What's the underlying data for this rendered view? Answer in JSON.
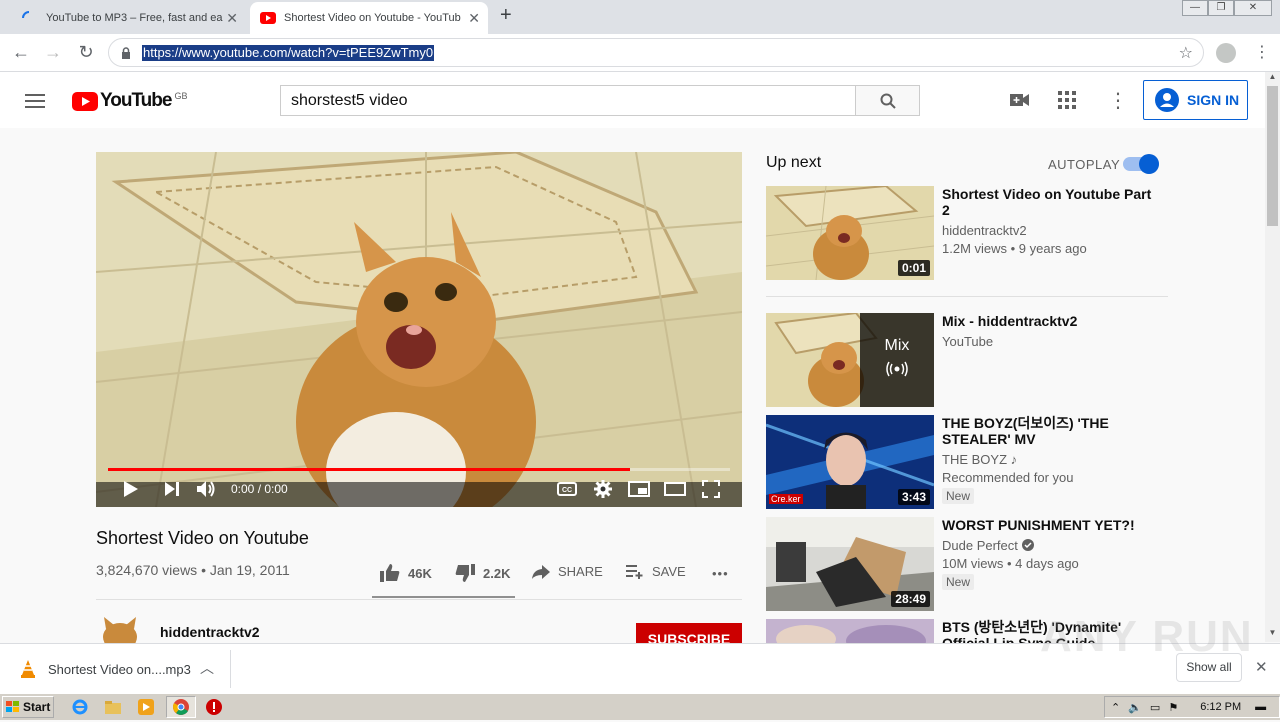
{
  "browser": {
    "tabs": [
      {
        "title": "YouTube to MP3 – Free, fast and ea",
        "close": "✕"
      },
      {
        "title": "Shortest Video on Youtube - YouTub",
        "close": "✕"
      }
    ],
    "new_tab": "+",
    "url": "https://www.youtube.com/watch?v=tPEE9ZwTmy0"
  },
  "youtube": {
    "logo_text": "YouTube",
    "region": "GB",
    "search_value": "shorstest5 video",
    "signin_label": "SIGN IN"
  },
  "video": {
    "time": "0:00 / 0:00",
    "progress_fraction": 0.84,
    "title": "Shortest Video on Youtube",
    "views_date": "3,824,670 views • Jan 19, 2011",
    "likes": "46K",
    "dislikes": "2.2K",
    "share_label": "SHARE",
    "save_label": "SAVE",
    "more": "•••",
    "channel": "hiddentracktv2",
    "subscribe_label": "SUBSCRIBE"
  },
  "sidebar": {
    "up_next": "Up next",
    "autoplay": "AUTOPLAY",
    "items": [
      {
        "title": "Shortest Video on Youtube Part 2",
        "channel": "hiddentracktv2",
        "meta": "1.2M views • 9 years ago",
        "duration": "0:01"
      },
      {
        "title": "Mix - hiddentracktv2",
        "channel": "YouTube",
        "mix_label": "Mix"
      },
      {
        "title": "THE BOYZ(더보이즈) 'THE STEALER' MV",
        "channel": "THE BOYZ",
        "meta": "Recommended for you",
        "badge": "New",
        "duration": "3:43",
        "thumb_text": "Cre.ker"
      },
      {
        "title": "WORST PUNISHMENT YET?!",
        "channel": "Dude Perfect",
        "meta": "10M views • 4 days ago",
        "badge": "New",
        "duration": "28:49"
      },
      {
        "title": "BTS (방탄소년단) 'Dynamite' Official Lip Sync Guide"
      }
    ]
  },
  "download": {
    "filename": "Shortest Video on....mp3",
    "show_all": "Show all"
  },
  "taskbar": {
    "start": "Start",
    "clock": "6:12 PM"
  },
  "watermark": "ANY RUN",
  "colors": {
    "yt_red": "#ff0000",
    "link_blue": "#065fd4",
    "progress_red": "#f00"
  }
}
